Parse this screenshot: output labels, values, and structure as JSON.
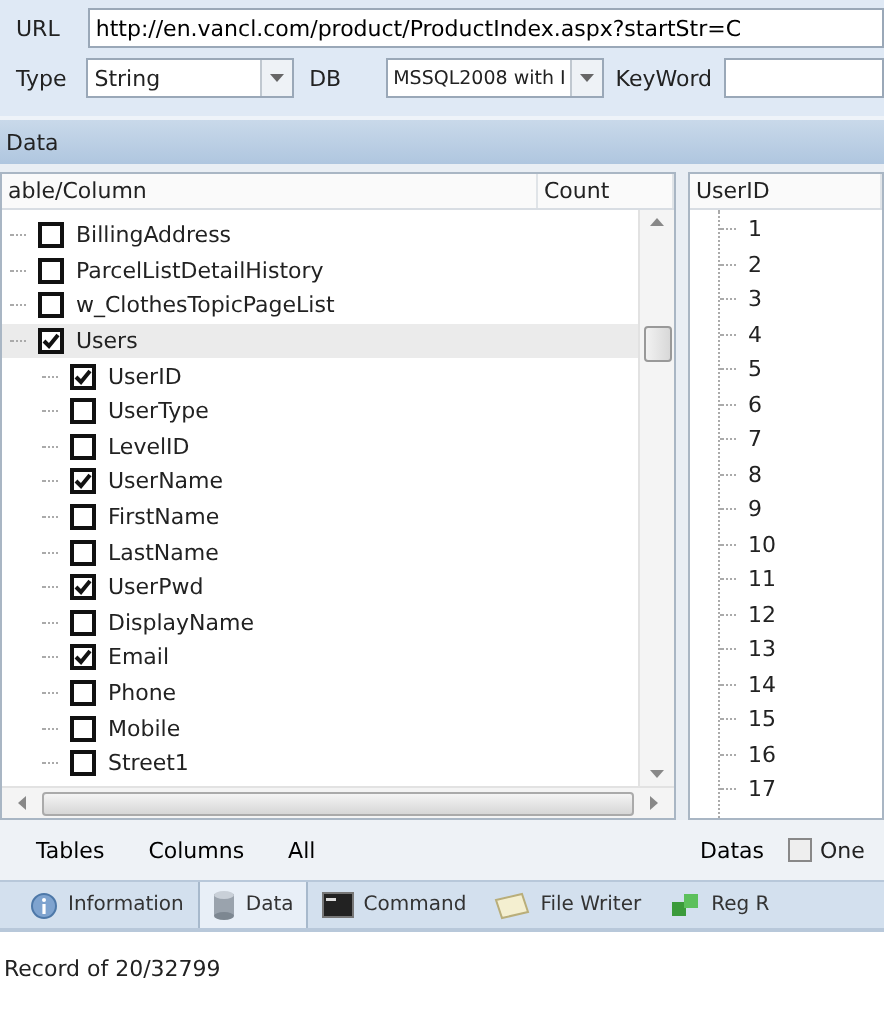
{
  "url": {
    "label": "URL",
    "value": "http://en.vancl.com/product/ProductIndex.aspx?startStr=C"
  },
  "type": {
    "label": "Type",
    "value": "String"
  },
  "db": {
    "label": "DB",
    "value": "MSSQL2008 with I"
  },
  "keyword": {
    "label": "KeyWord"
  },
  "section_title": "Data",
  "tree": {
    "columns": [
      "able/Column",
      "Count"
    ],
    "items": [
      {
        "label": "BillingAddress",
        "checked": false
      },
      {
        "label": "ParcelListDetailHistory",
        "checked": false
      },
      {
        "label": "w_ClothesTopicPageList",
        "checked": false
      },
      {
        "label": "Users",
        "checked": true,
        "selected": true,
        "children": [
          {
            "label": "UserID",
            "checked": true
          },
          {
            "label": "UserType",
            "checked": false
          },
          {
            "label": "LevelID",
            "checked": false
          },
          {
            "label": "UserName",
            "checked": true
          },
          {
            "label": "FirstName",
            "checked": false
          },
          {
            "label": "LastName",
            "checked": false
          },
          {
            "label": "UserPwd",
            "checked": true
          },
          {
            "label": "DisplayName",
            "checked": false
          },
          {
            "label": "Email",
            "checked": true
          },
          {
            "label": "Phone",
            "checked": false
          },
          {
            "label": "Mobile",
            "checked": false
          },
          {
            "label": "Street1",
            "checked": false
          }
        ]
      }
    ]
  },
  "tree_buttons": [
    "Tables",
    "Columns",
    "All"
  ],
  "values": {
    "column": "UserID",
    "rows": [
      "1",
      "2",
      "3",
      "4",
      "5",
      "6",
      "7",
      "8",
      "9",
      "10",
      "11",
      "12",
      "13",
      "14",
      "15",
      "16",
      "17"
    ]
  },
  "values_buttons": {
    "label": "Datas",
    "option": {
      "label": "One",
      "checked": false
    }
  },
  "tabs": [
    {
      "label": "Information",
      "selected": false
    },
    {
      "label": "Data",
      "selected": true
    },
    {
      "label": "Command",
      "selected": false
    },
    {
      "label": "File Writer",
      "selected": false
    },
    {
      "label": "Reg R",
      "selected": false
    }
  ],
  "status": "Record of 20/32799"
}
